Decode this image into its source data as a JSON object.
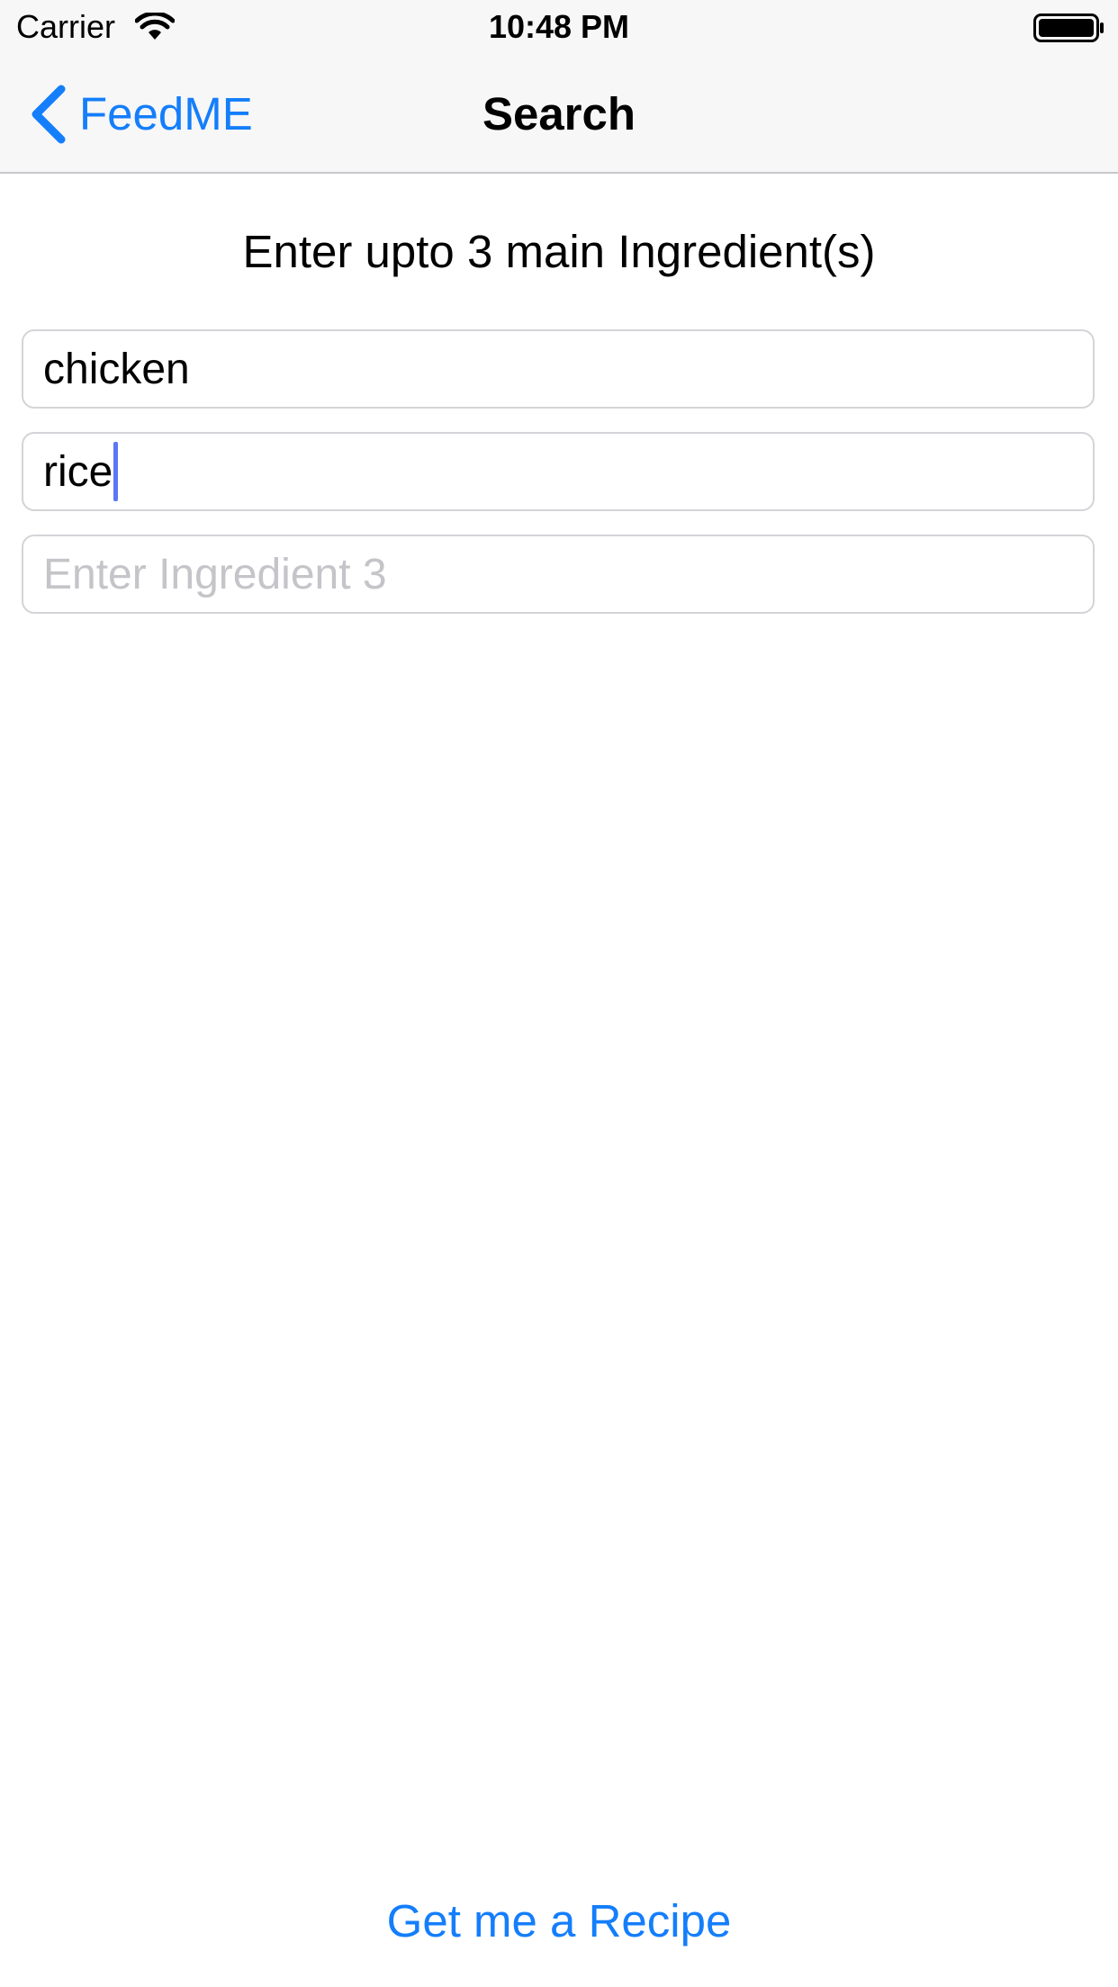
{
  "status_bar": {
    "carrier": "Carrier",
    "time": "10:48 PM",
    "wifi_icon": "wifi-icon",
    "battery_icon": "battery-icon"
  },
  "nav_bar": {
    "back_label": "FeedME",
    "back_icon": "chevron-left-icon",
    "title": "Search"
  },
  "main": {
    "instruction": "Enter upto 3 main Ingredient(s)",
    "fields": [
      {
        "value": "chicken",
        "placeholder": ""
      },
      {
        "value": "rice",
        "placeholder": "",
        "focused": true
      },
      {
        "value": "",
        "placeholder": "Enter Ingredient 3"
      }
    ],
    "action_label": "Get me a Recipe"
  },
  "colors": {
    "accent": "#147efb",
    "nav_background": "#f7f7f7",
    "field_border": "#d4d4d8",
    "placeholder": "#c4c4c9",
    "caret": "#5b76f7"
  }
}
